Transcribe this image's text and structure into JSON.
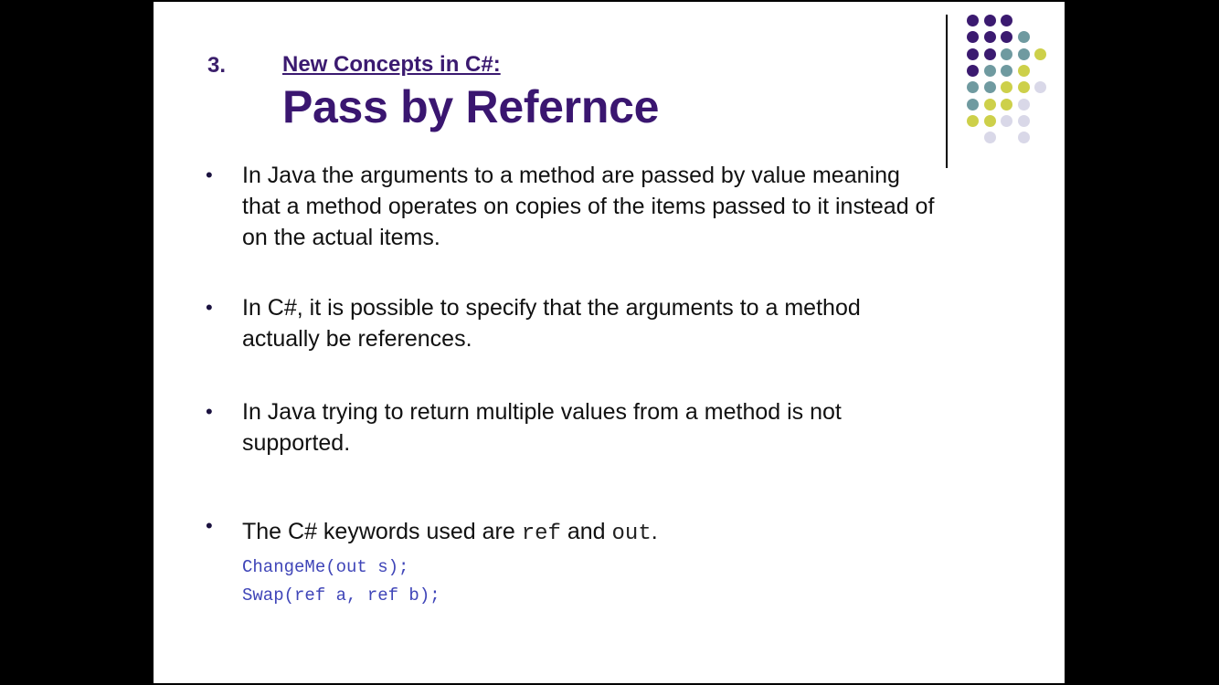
{
  "slide": {
    "number": "3.",
    "subtitle": "New Concepts in C#:",
    "title": "Pass by Refernce"
  },
  "bullets": [
    "In Java the arguments to a method are passed by value meaning\nthat a method operates on copies of the items passed to it instead of\non the actual items.",
    "In C#, it is possible to specify that the arguments to a method\nactually be references.",
    "In Java trying to return multiple values from a method is not\nsupported."
  ],
  "keywords_bullet": {
    "prefix": "The C# keywords used are ",
    "kw1": "ref",
    "middle": " and ",
    "kw2": "out",
    "suffix": "."
  },
  "code_lines": [
    "ChangeMe(out s);",
    "Swap(ref a, ref b);"
  ],
  "colors": {
    "purple": "#3b1a70",
    "teal": "#6f9aa0",
    "olive": "#cdd04a",
    "lavender": "#d9d8e8",
    "code": "#3f45b8"
  }
}
